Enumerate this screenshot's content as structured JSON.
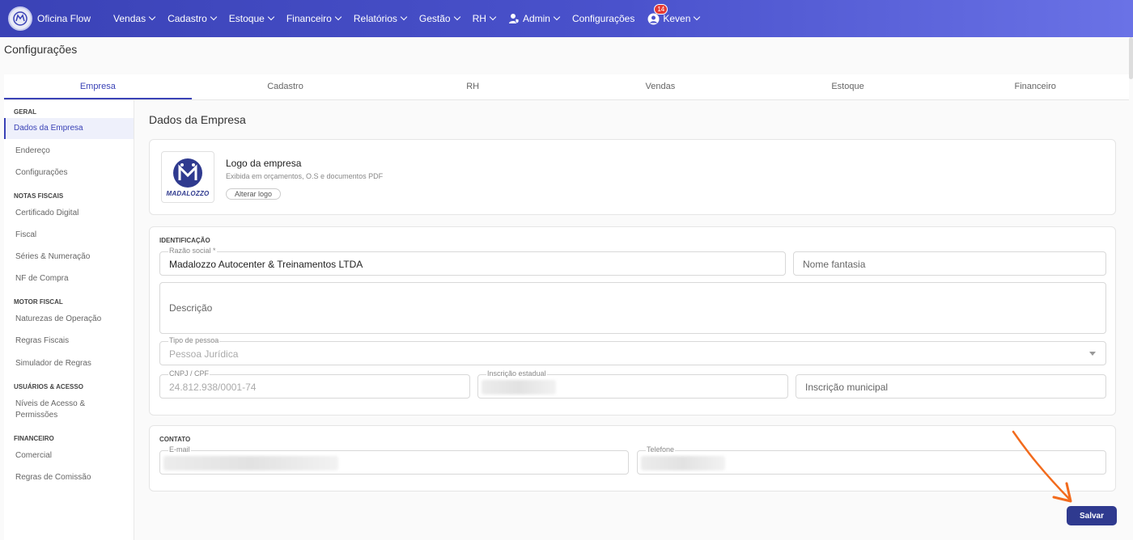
{
  "app": {
    "name": "Oficina Flow"
  },
  "nav": {
    "items": [
      {
        "label": "Vendas",
        "chevron": true
      },
      {
        "label": "Cadastro",
        "chevron": true
      },
      {
        "label": "Estoque",
        "chevron": true
      },
      {
        "label": "Financeiro",
        "chevron": true
      },
      {
        "label": "Relatórios",
        "chevron": true
      },
      {
        "label": "Gestão",
        "chevron": true
      },
      {
        "label": "RH",
        "chevron": true
      },
      {
        "label": "Admin",
        "chevron": true,
        "icon": "user-shield-icon"
      },
      {
        "label": "Configurações",
        "chevron": false
      }
    ],
    "user": {
      "name": "Keven",
      "notifications": "14",
      "icon": "user-circle-icon"
    }
  },
  "page": {
    "title": "Configurações"
  },
  "tabs": [
    {
      "label": "Empresa",
      "active": true
    },
    {
      "label": "Cadastro",
      "active": false
    },
    {
      "label": "RH",
      "active": false
    },
    {
      "label": "Vendas",
      "active": false
    },
    {
      "label": "Estoque",
      "active": false
    },
    {
      "label": "Financeiro",
      "active": false
    }
  ],
  "sidebar": {
    "sections": [
      {
        "title": "GERAL",
        "items": [
          {
            "label": "Dados da Empresa",
            "active": true
          },
          {
            "label": "Endereço"
          },
          {
            "label": "Configurações"
          }
        ]
      },
      {
        "title": "NOTAS FISCAIS",
        "items": [
          {
            "label": "Certificado Digital"
          },
          {
            "label": "Fiscal"
          },
          {
            "label": "Séries & Numeração"
          },
          {
            "label": "NF de Compra"
          }
        ]
      },
      {
        "title": "MOTOR FISCAL",
        "items": [
          {
            "label": "Naturezas de Operação"
          },
          {
            "label": "Regras Fiscais"
          },
          {
            "label": "Simulador de Regras"
          }
        ]
      },
      {
        "title": "USUÁRIOS & ACESSO",
        "items": [
          {
            "label": "Níveis de Acesso & Permissões"
          }
        ]
      },
      {
        "title": "FINANCEIRO",
        "items": [
          {
            "label": "Comercial"
          },
          {
            "label": "Regras de Comissão"
          }
        ]
      }
    ]
  },
  "main": {
    "section_title": "Dados da Empresa",
    "logo": {
      "title": "Logo da empresa",
      "subtitle": "Exibida em orçamentos, O.S e documentos PDF",
      "button": "Alterar logo",
      "brand_text": "MADALOZZO"
    },
    "identificacao": {
      "label": "IDENTIFICAÇÃO",
      "razao_social_label": "Razão social *",
      "razao_social_value": "Madalozzo Autocenter & Treinamentos LTDA",
      "nome_fantasia_placeholder": "Nome fantasia",
      "descricao_placeholder": "Descrição",
      "tipo_pessoa_label": "Tipo de pessoa",
      "tipo_pessoa_value": "Pessoa Jurídica",
      "cnpj_label": "CNPJ / CPF",
      "cnpj_value": "24.812.938/0001-74",
      "ie_label": "Inscrição estadual",
      "im_placeholder": "Inscrição municipal"
    },
    "contato": {
      "label": "CONTATO",
      "email_label": "E-mail",
      "telefone_label": "Telefone"
    },
    "save_label": "Salvar"
  },
  "colors": {
    "brand": "#3a42b6",
    "save_button": "#2f3a8f",
    "annotation_arrow": "#f26b1d"
  }
}
